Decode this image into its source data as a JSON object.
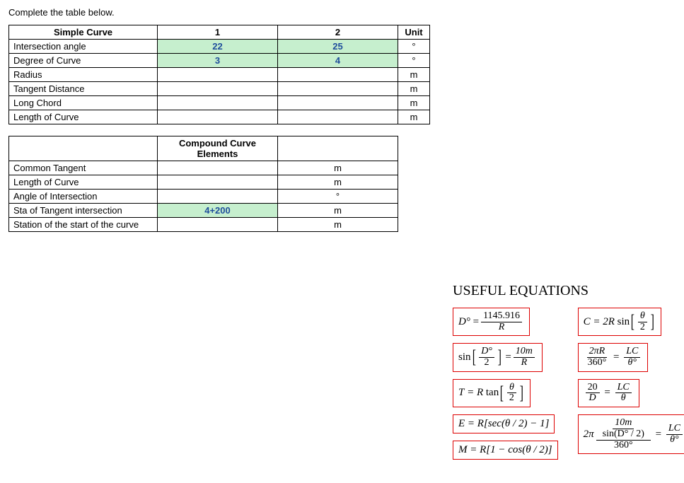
{
  "instruction": "Complete the table below.",
  "table1": {
    "headers": {
      "c0": "Simple Curve",
      "c1": "1",
      "c2": "2",
      "c3": "Unit"
    },
    "rows": [
      {
        "label": "Intersection angle",
        "v1": "22",
        "v2": "25",
        "unit": "°"
      },
      {
        "label": "Degree of Curve",
        "v1": "3",
        "v2": "4",
        "unit": "°"
      },
      {
        "label": "Radius",
        "v1": "",
        "v2": "",
        "unit": "m"
      },
      {
        "label": "Tangent Distance",
        "v1": "",
        "v2": "",
        "unit": "m"
      },
      {
        "label": "Long Chord",
        "v1": "",
        "v2": "",
        "unit": "m"
      },
      {
        "label": "Length of Curve",
        "v1": "",
        "v2": "",
        "unit": "m"
      }
    ]
  },
  "table2": {
    "headers": {
      "c0": "",
      "c1": "Compound Curve Elements",
      "c2": ""
    },
    "rows": [
      {
        "label": "Common Tangent",
        "value": "",
        "unit": "m"
      },
      {
        "label": "Length of Curve",
        "value": "",
        "unit": "m"
      },
      {
        "label": "Angle of Intersection",
        "value": "",
        "unit": "°"
      },
      {
        "label": "Sta of Tangent intersection",
        "value": "4+200",
        "unit": "m"
      },
      {
        "label": "Station of the start of the curve",
        "value": "",
        "unit": "m"
      }
    ]
  },
  "equations": {
    "title": "USEFUL EQUATIONS",
    "left": {
      "eq1": {
        "lhs": "D°",
        "eq": "=",
        "num": "1145.916",
        "den": "R"
      },
      "eq2": {
        "fn": "sin",
        "bnum": "D°",
        "bden": "2",
        "eq": "=",
        "num": "10m",
        "den": "R"
      },
      "eq3": {
        "lhs": "T",
        "eq": "= R",
        "fn": "tan",
        "bnum": "θ",
        "bden": "2"
      },
      "eq4": {
        "text": "E = R[sec(θ / 2) − 1]"
      },
      "eq5": {
        "text": "M = R[1 − cos(θ / 2)]"
      }
    },
    "right": {
      "eq1": {
        "lhs": "C",
        "eq": "= 2R",
        "fn": "sin",
        "bnum": "θ",
        "bden": "2"
      },
      "eq2": {
        "lnum": "2πR",
        "lden": "360°",
        "eq": "=",
        "rnum": "LC",
        "rden": "θ°"
      },
      "eq3": {
        "lnum": "20",
        "lden": "D",
        "eq": "=",
        "rnum": "LC",
        "rden": "θ"
      },
      "eq4": {
        "pre": "2π",
        "tnum": "10m",
        "tden": "sin(D° / 2)",
        "bden": "360°",
        "eq": "=",
        "rnum": "LC",
        "rden": "θ°"
      }
    }
  }
}
